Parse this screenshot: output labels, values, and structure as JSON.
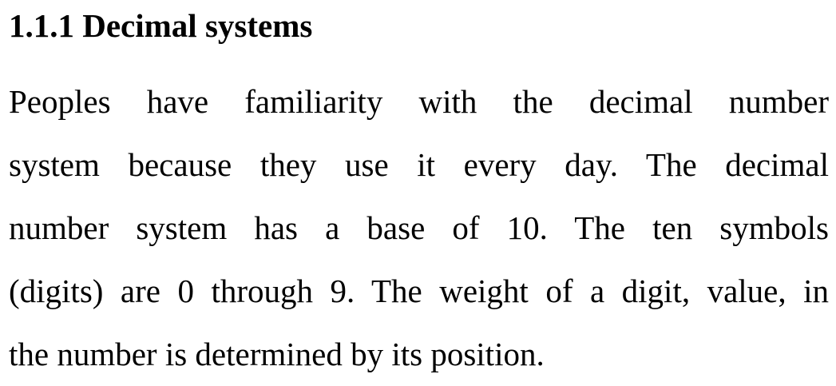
{
  "section": {
    "heading": "1.1.1 Decimal systems",
    "paragraph_lines": [
      "Peoples have familiarity with the decimal number",
      "system because they use it every day. The decimal",
      "number system has a base of 10. The ten symbols",
      "(digits) are 0 through 9. The weight of a digit, value, in",
      "the number is determined by its position."
    ]
  }
}
